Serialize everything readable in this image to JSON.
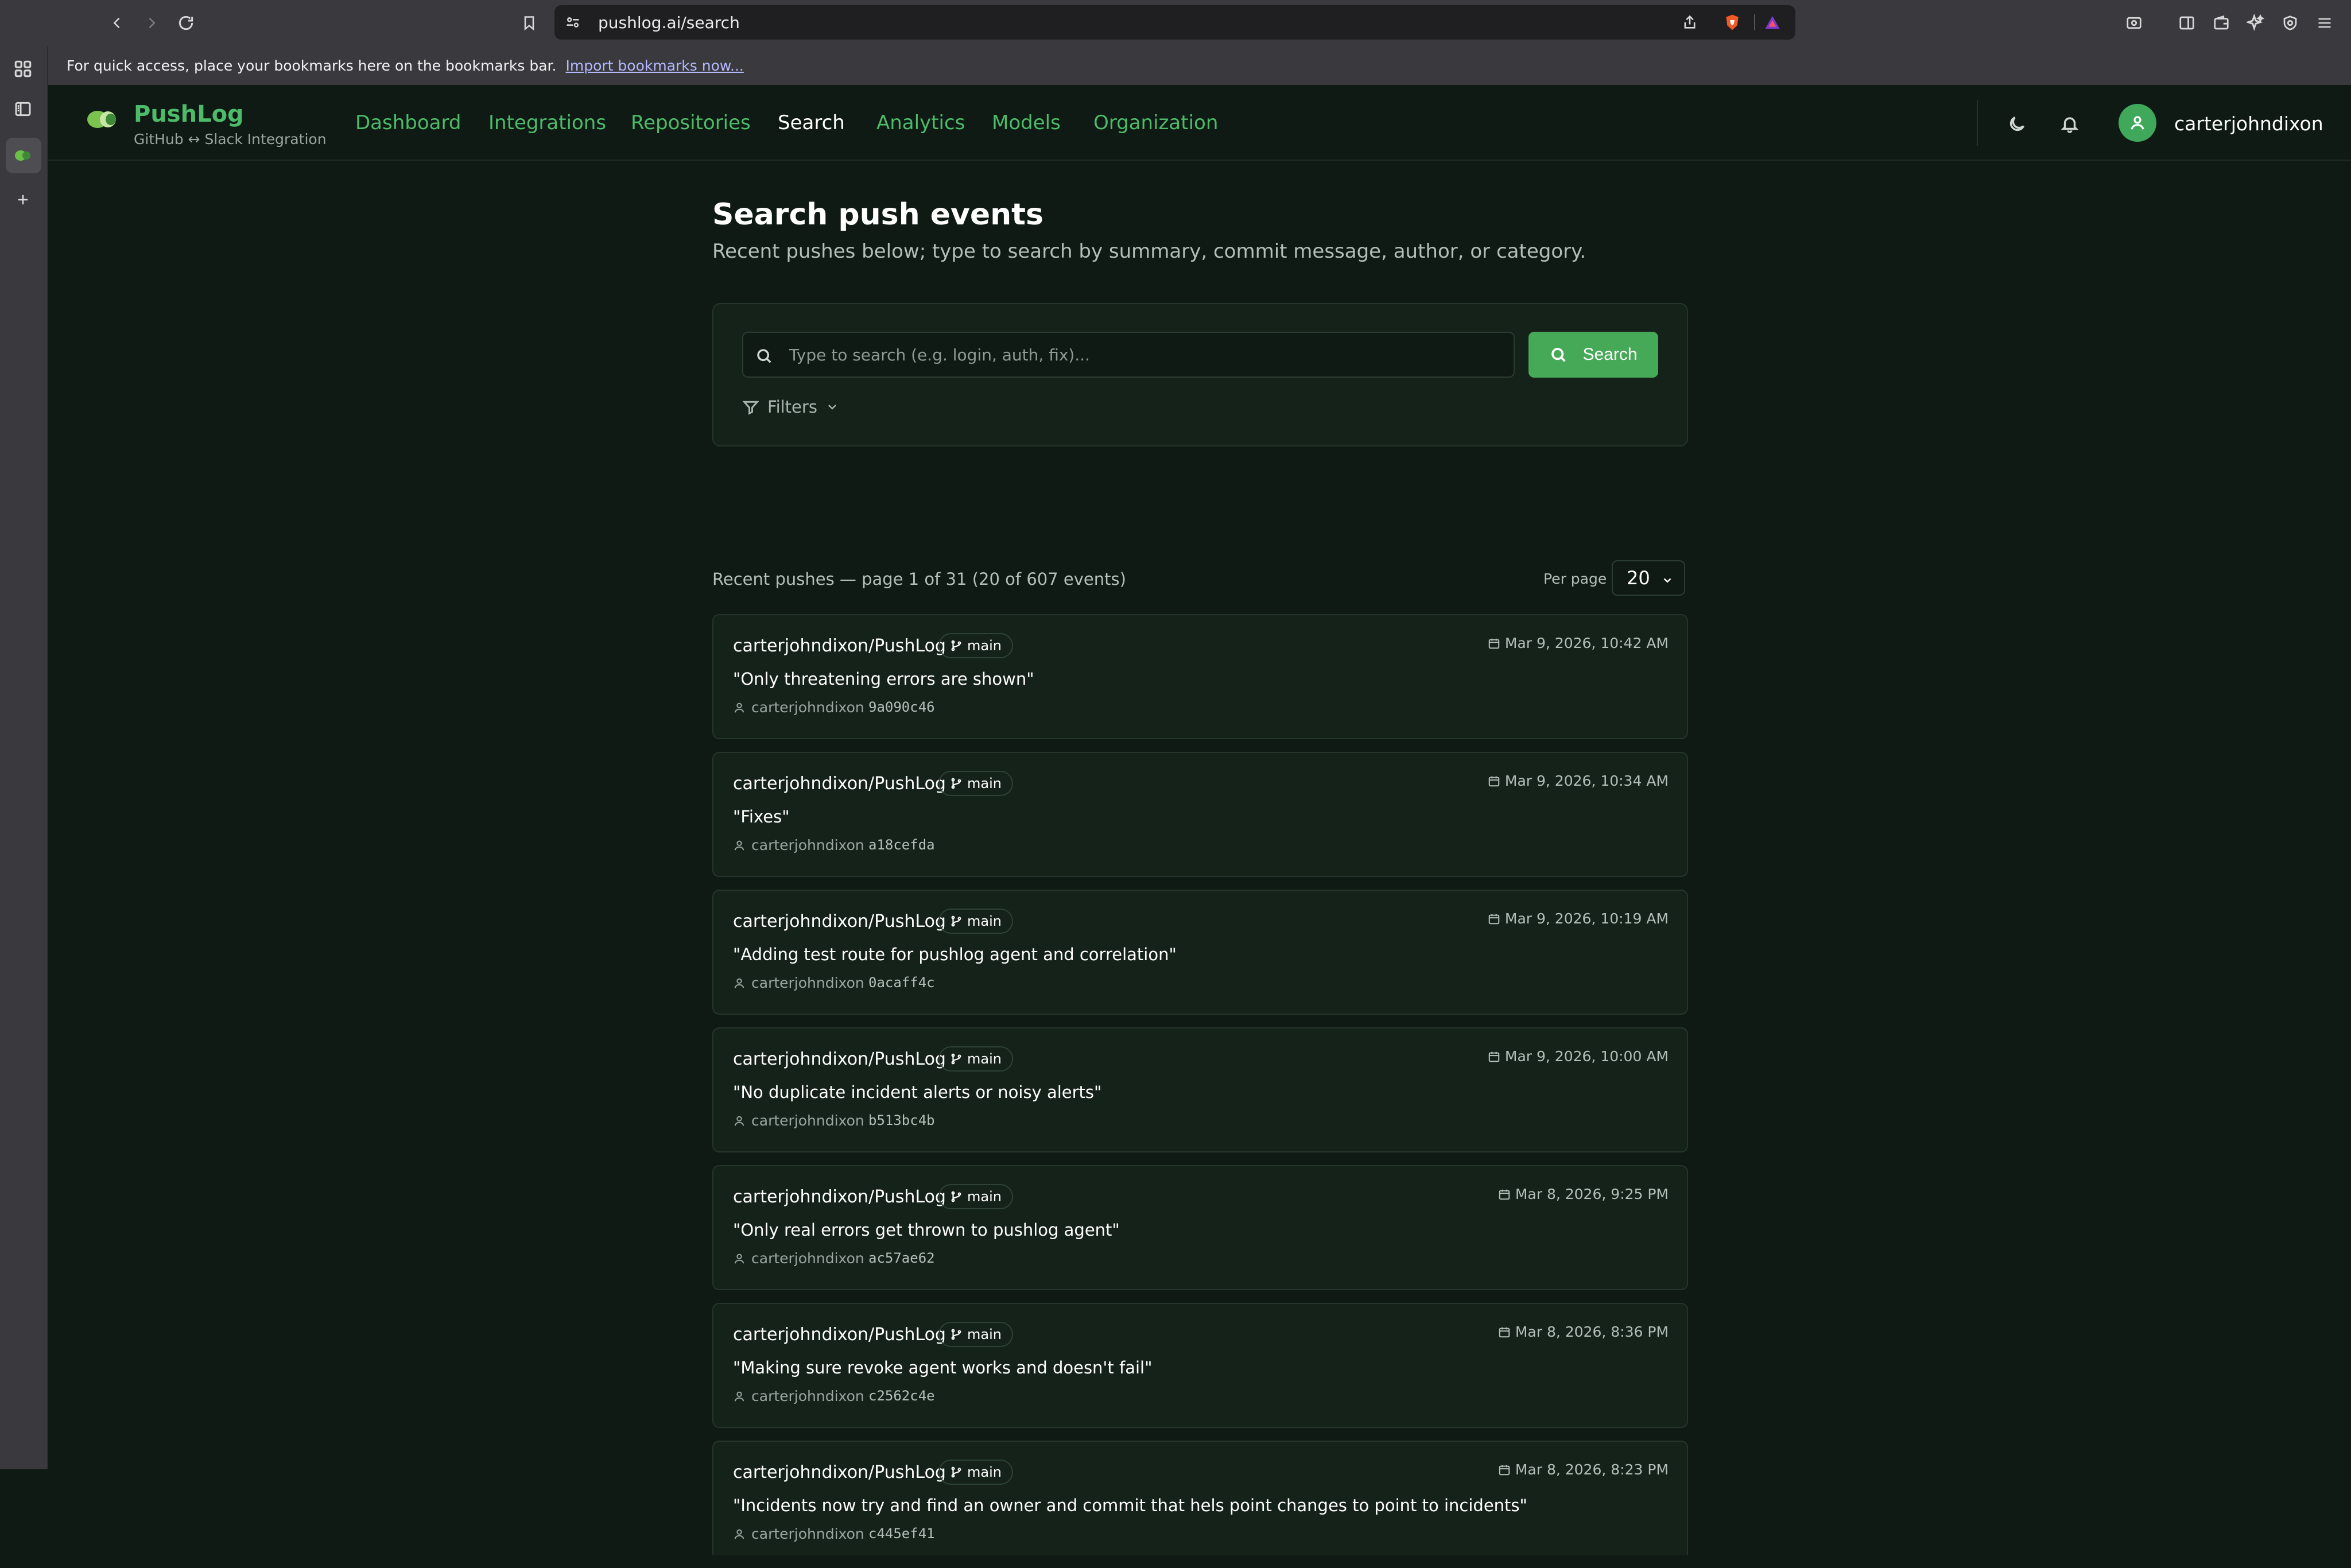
{
  "browser": {
    "url": "pushlog.ai/search",
    "bookmarks_prompt": "For quick access, place your bookmarks here on the bookmarks bar.",
    "import_link": "Import bookmarks now..."
  },
  "header": {
    "brand_name": "PushLog",
    "brand_subtitle": "GitHub ↔ Slack Integration",
    "nav": [
      {
        "label": "Dashboard",
        "active": false
      },
      {
        "label": "Integrations",
        "active": false
      },
      {
        "label": "Repositories",
        "active": false
      },
      {
        "label": "Search",
        "active": true
      },
      {
        "label": "Analytics",
        "active": false
      },
      {
        "label": "Models",
        "active": false
      },
      {
        "label": "Organization",
        "active": false
      }
    ],
    "username": "carterjohndixon"
  },
  "main": {
    "title": "Search push events",
    "subtitle": "Recent pushes below; type to search by summary, commit message, author, or category.",
    "search": {
      "placeholder": "Type to search (e.g. login, auth, fix)...",
      "value": "",
      "button_label": "Search"
    },
    "filters_label": "Filters",
    "results_summary": "Recent pushes — page 1 of 31 (20 of 607 events)",
    "per_page_label": "Per page",
    "per_page_value": "20",
    "events": [
      {
        "repo": "carterjohndixon/PushLog",
        "branch": "main",
        "date": "Mar 9, 2026, 10:42 AM",
        "message": "\"Only threatening errors are shown\"",
        "author": "carterjohndixon",
        "sha": "9a090c46"
      },
      {
        "repo": "carterjohndixon/PushLog",
        "branch": "main",
        "date": "Mar 9, 2026, 10:34 AM",
        "message": "\"Fixes\"",
        "author": "carterjohndixon",
        "sha": "a18cefda"
      },
      {
        "repo": "carterjohndixon/PushLog",
        "branch": "main",
        "date": "Mar 9, 2026, 10:19 AM",
        "message": "\"Adding test route for pushlog agent and correlation\"",
        "author": "carterjohndixon",
        "sha": "0acaff4c"
      },
      {
        "repo": "carterjohndixon/PushLog",
        "branch": "main",
        "date": "Mar 9, 2026, 10:00 AM",
        "message": "\"No duplicate incident alerts or noisy alerts\"",
        "author": "carterjohndixon",
        "sha": "b513bc4b"
      },
      {
        "repo": "carterjohndixon/PushLog",
        "branch": "main",
        "date": "Mar 8, 2026, 9:25 PM",
        "message": "\"Only real errors get thrown to pushlog agent\"",
        "author": "carterjohndixon",
        "sha": "ac57ae62"
      },
      {
        "repo": "carterjohndixon/PushLog",
        "branch": "main",
        "date": "Mar 8, 2026, 8:36 PM",
        "message": "\"Making sure revoke agent works and doesn't fail\"",
        "author": "carterjohndixon",
        "sha": "c2562c4e"
      },
      {
        "repo": "carterjohndixon/PushLog",
        "branch": "main",
        "date": "Mar 8, 2026, 8:23 PM",
        "message": "\"Incidents now try and find an owner and commit that hels point changes to point to incidents\"",
        "author": "carterjohndixon",
        "sha": "c445ef41"
      }
    ]
  }
}
